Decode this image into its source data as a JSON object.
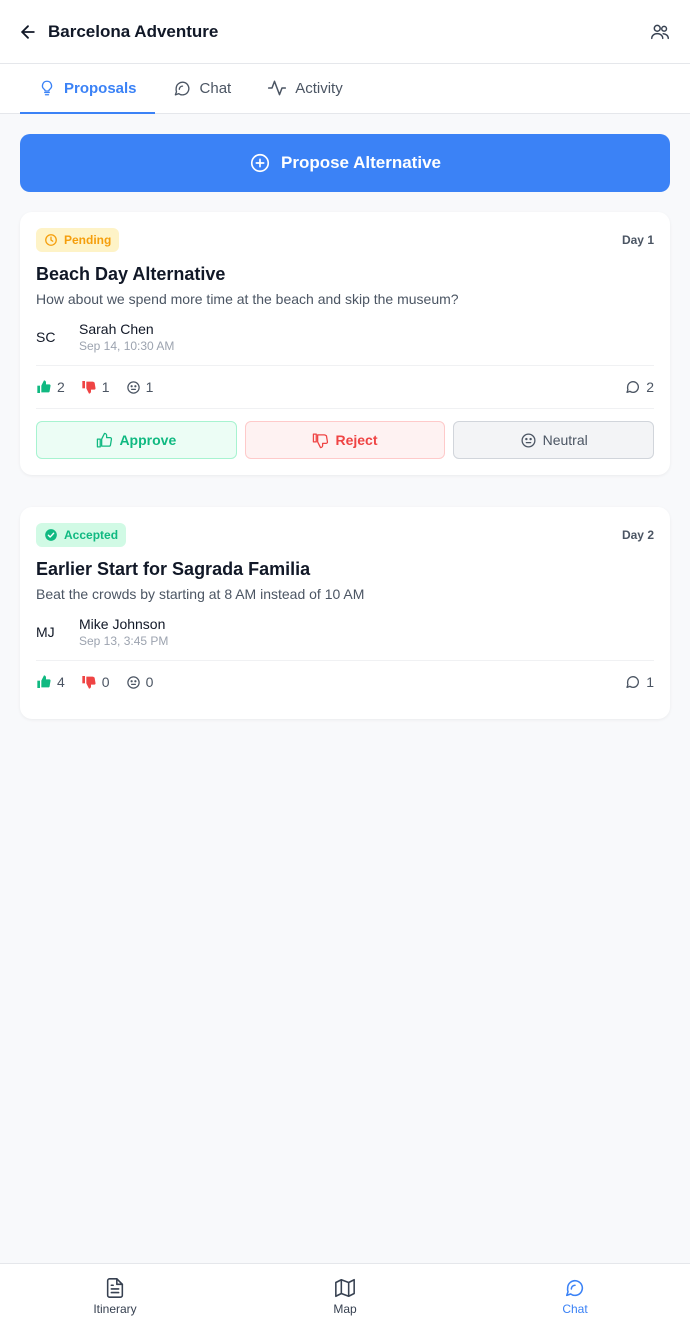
{
  "header": {
    "title": "Barcelona Adventure"
  },
  "tabs": [
    {
      "label": "Proposals",
      "active": true,
      "icon": "lightbulb-icon"
    },
    {
      "label": "Chat",
      "active": false,
      "icon": "chat-bubble-icon"
    },
    {
      "label": "Activity",
      "active": false,
      "icon": "activity-icon"
    }
  ],
  "propose_button": {
    "label": "Propose Alternative"
  },
  "proposals": [
    {
      "status": "Pending",
      "day": "Day 1",
      "title": "Beach Day Alternative",
      "description": "How about we spend more time at the beach and skip the museum?",
      "author_initials": "SC",
      "author_name": "Sarah Chen",
      "time": "Sep 14, 10:30 AM",
      "approvals": "2",
      "rejections": "1",
      "neutral": "1",
      "comments": "2",
      "actions": {
        "approve": "Approve",
        "reject": "Reject",
        "neutral": "Neutral"
      }
    },
    {
      "status": "Accepted",
      "day": "Day 2",
      "title": "Earlier Start for Sagrada Familia",
      "description": "Beat the crowds by starting at 8 AM instead of 10 AM",
      "author_initials": "MJ",
      "author_name": "Mike Johnson",
      "time": "Sep 13, 3:45 PM",
      "approvals": "4",
      "rejections": "0",
      "neutral": "0",
      "comments": "1"
    }
  ],
  "bottom_nav": [
    {
      "label": "Itinerary",
      "icon": "document-icon",
      "active": false
    },
    {
      "label": "Map",
      "icon": "map-icon",
      "active": false
    },
    {
      "label": "Chat",
      "icon": "chat-bubble-icon",
      "active": true
    }
  ],
  "colors": {
    "primary": "#3b82f6",
    "pending": "#f59e0b",
    "accepted": "#10b981",
    "reject": "#ef4444"
  }
}
